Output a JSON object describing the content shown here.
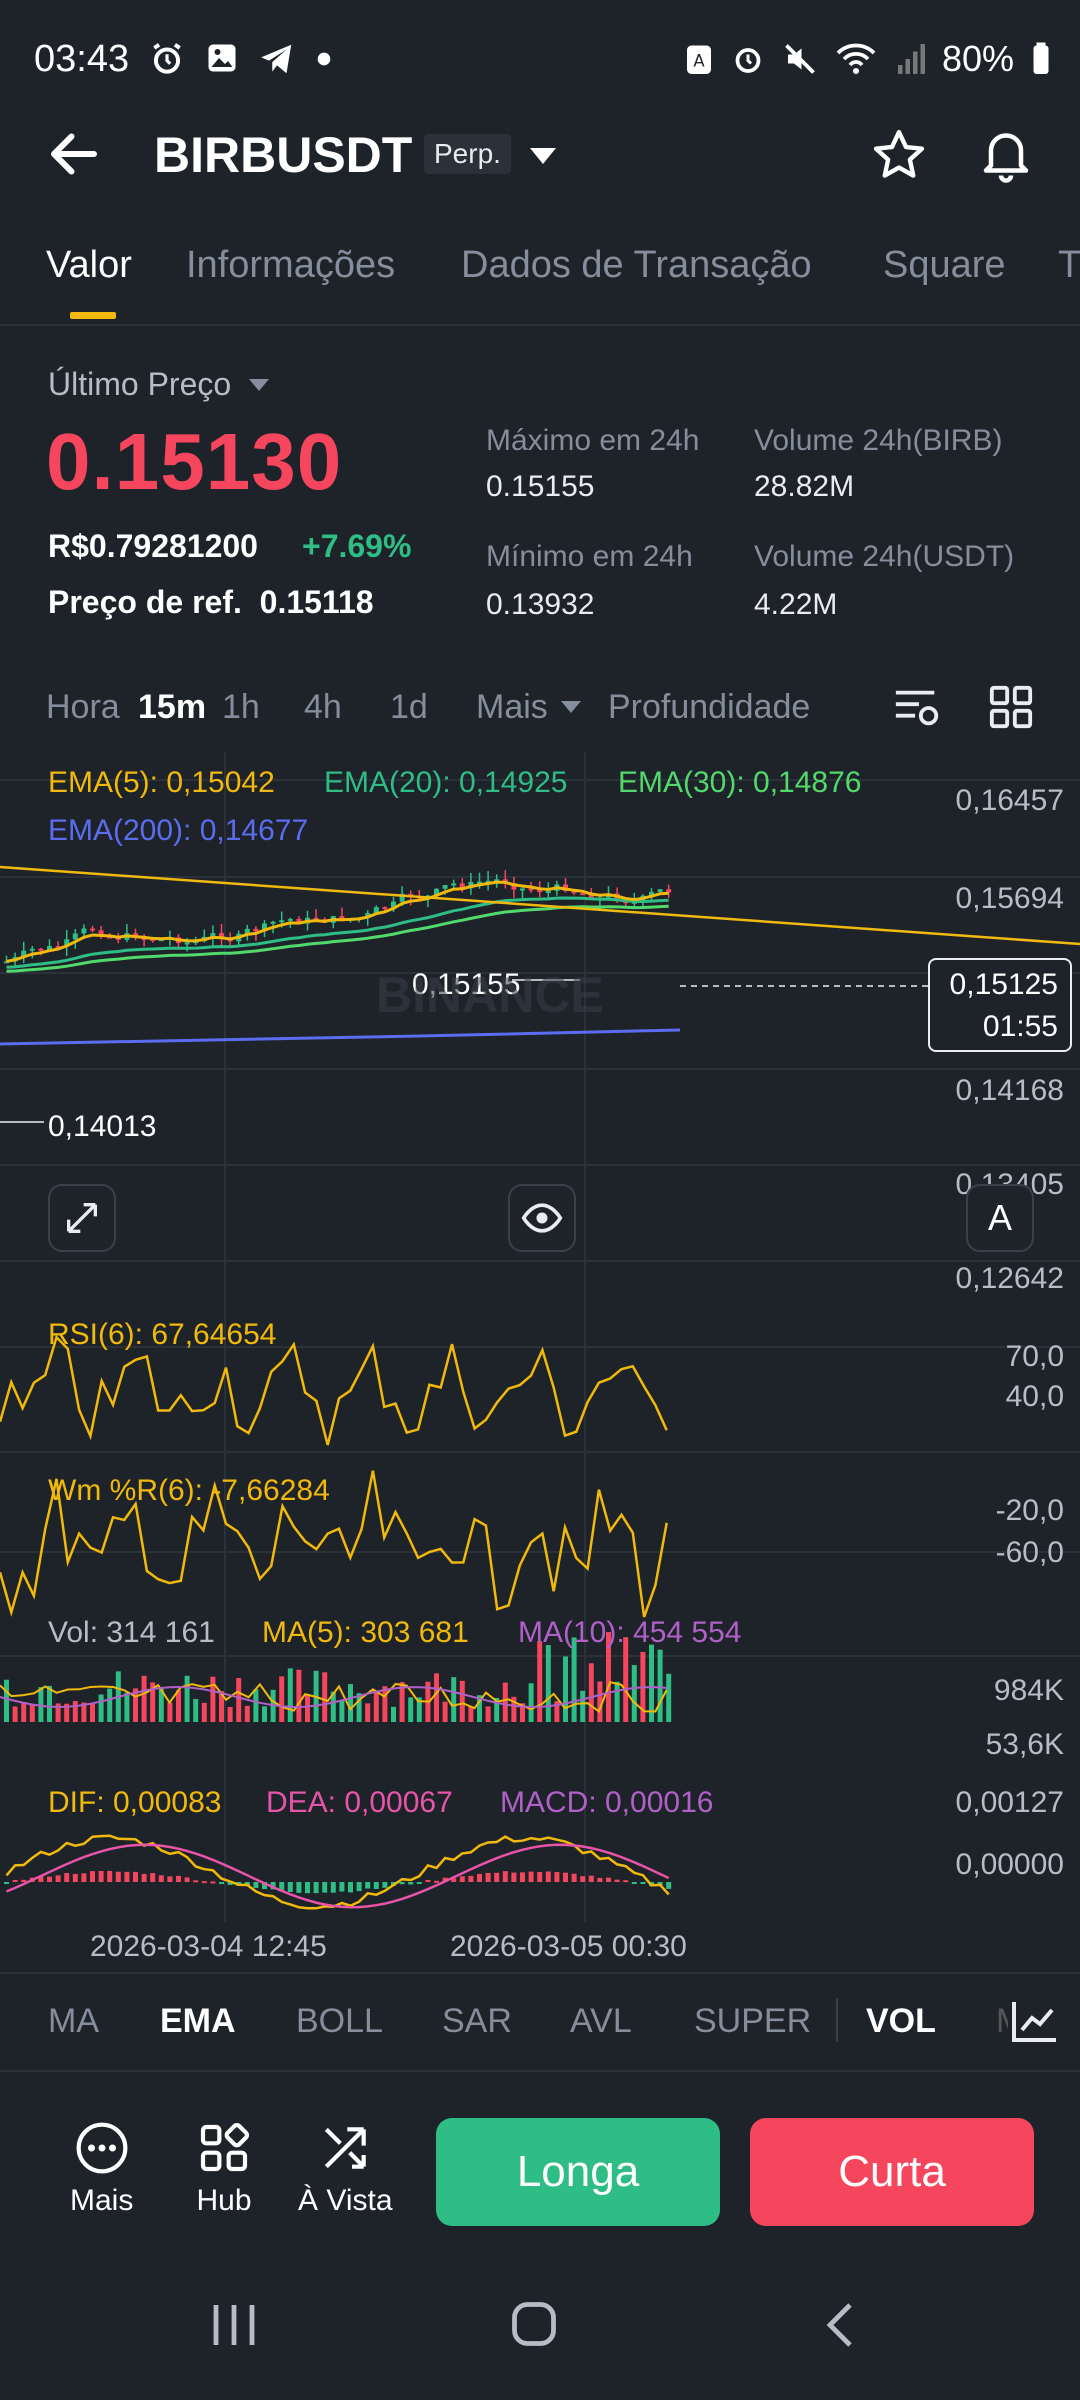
{
  "status_bar": {
    "time": "03:43",
    "battery": "80%"
  },
  "header": {
    "symbol": "BIRBUSDT",
    "badge": "Perp."
  },
  "tabs": [
    "Valor",
    "Informações",
    "Dados de Transação",
    "Square",
    "T"
  ],
  "price": {
    "last_label": "Último Preço",
    "last": "0.15130",
    "fiat": "R$0.79281200",
    "change": "+7.69%",
    "ref_label": "Preço de ref.",
    "ref": "0.15118"
  },
  "stats": {
    "high_label": "Máximo em 24h",
    "high": "0.15155",
    "vol_birb_label": "Volume 24h(BIRB)",
    "vol_birb": "28.82M",
    "low_label": "Mínimo em 24h",
    "low": "0.13932",
    "vol_usdt_label": "Volume 24h(USDT)",
    "vol_usdt": "4.22M"
  },
  "intervals": {
    "hora": "Hora",
    "i15m": "15m",
    "i1h": "1h",
    "i4h": "4h",
    "i1d": "1d",
    "mais": "Mais",
    "prof": "Profundidade"
  },
  "ema_legend": {
    "ema5": "EMA(5): 0,15042",
    "ema20": "EMA(20): 0,14925",
    "ema30": "EMA(30): 0,14876",
    "ema200": "EMA(200): 0,14677"
  },
  "price_axis": [
    "0,16457",
    "0,15694",
    "0,14168",
    "0,13405",
    "0,12642"
  ],
  "markers": {
    "max": "0,15155",
    "min": "0,14013",
    "current": "0,15125",
    "countdown": "01:55",
    "watermark": "BINANCE"
  },
  "rsi": {
    "label": "RSI(6): 67,64654",
    "axis_top": "70,0",
    "axis_bottom": "40,0"
  },
  "wr": {
    "label": "Wm %R(6): -7,66284",
    "axis_top": "-20,0",
    "axis_bottom": "-60,0"
  },
  "vol": {
    "label": "Vol: 314 161",
    "ma5": "MA(5): 303 681",
    "ma10": "MA(10): 454 554",
    "axis_top": "984K",
    "axis_bottom": "53,6K"
  },
  "macd": {
    "dif": "DIF: 0,00083",
    "dea": "DEA: 0,00067",
    "macd": "MACD: 0,00016",
    "axis_top": "0,00127",
    "axis_bottom": "0,00000"
  },
  "dates": [
    "2026-03-04 12:45",
    "2026-03-05 00:30"
  ],
  "indicator_tabs": [
    "MA",
    "EMA",
    "BOLL",
    "SAR",
    "AVL",
    "SUPER",
    "VOL",
    "M"
  ],
  "actions": {
    "mais": "Mais",
    "hub": "Hub",
    "avista": "À Vista",
    "long": "Longa",
    "short": "Curta"
  },
  "colors": {
    "bg": "#1e2329",
    "up": "#2ebd85",
    "down": "#f6465d",
    "accent": "#f0b90b",
    "ema5": "#f0b90b",
    "ema20": "#2ebd85",
    "ema30": "#52d96b",
    "ema200": "#5b6cf0",
    "ma10": "#b061c8",
    "dea": "#e754a8"
  }
}
